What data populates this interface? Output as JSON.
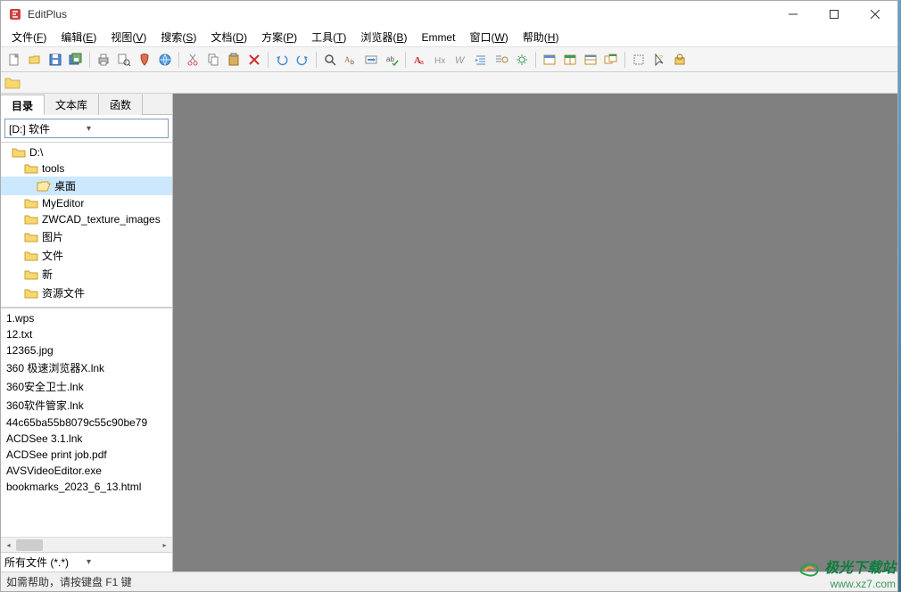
{
  "window": {
    "title": "EditPlus"
  },
  "menubar": [
    {
      "label": "文件",
      "key": "F"
    },
    {
      "label": "编辑",
      "key": "E"
    },
    {
      "label": "视图",
      "key": "V"
    },
    {
      "label": "搜索",
      "key": "S"
    },
    {
      "label": "文档",
      "key": "D"
    },
    {
      "label": "方案",
      "key": "P"
    },
    {
      "label": "工具",
      "key": "T"
    },
    {
      "label": "浏览器",
      "key": "B"
    },
    {
      "label": "Emmet",
      "key": ""
    },
    {
      "label": "窗口",
      "key": "W"
    },
    {
      "label": "帮助",
      "key": "H"
    }
  ],
  "toolbar_icons": [
    "new-file",
    "open-file",
    "save-file",
    "save-all",
    "sep",
    "print",
    "print-preview",
    "toggle-marker",
    "browser-preview",
    "sep",
    "cut",
    "copy",
    "paste",
    "delete",
    "sep",
    "undo",
    "redo",
    "sep",
    "find",
    "replace",
    "goto",
    "spell-check",
    "sep",
    "font-settings",
    "heading",
    "word-wrap",
    "indent",
    "outdent",
    "settings",
    "sep",
    "window-1",
    "window-2",
    "window-3",
    "window-4",
    "sep",
    "cursor-mode",
    "help",
    "preferences"
  ],
  "sidebar": {
    "tabs": [
      "目录",
      "文本库",
      "函数"
    ],
    "active_tab": 0,
    "drive": "[D:] 软件",
    "tree": [
      {
        "label": "D:\\",
        "depth": 0,
        "open": false,
        "selected": false
      },
      {
        "label": "tools",
        "depth": 1,
        "open": false,
        "selected": false
      },
      {
        "label": "桌面",
        "depth": 2,
        "open": true,
        "selected": true
      },
      {
        "label": "MyEditor",
        "depth": 1,
        "open": false,
        "selected": false
      },
      {
        "label": "ZWCAD_texture_images",
        "depth": 1,
        "open": false,
        "selected": false
      },
      {
        "label": "图片",
        "depth": 1,
        "open": false,
        "selected": false
      },
      {
        "label": "文件",
        "depth": 1,
        "open": false,
        "selected": false
      },
      {
        "label": "新",
        "depth": 1,
        "open": false,
        "selected": false
      },
      {
        "label": "资源文件",
        "depth": 1,
        "open": false,
        "selected": false
      }
    ],
    "files": [
      "1.wps",
      "12.txt",
      "12365.jpg",
      "360 极速浏览器X.lnk",
      "360安全卫士.lnk",
      "360软件管家.lnk",
      "44c65ba55b8079c55c90be79",
      "ACDSee 3.1.lnk",
      "ACDSee print job.pdf",
      "AVSVideoEditor.exe",
      "bookmarks_2023_6_13.html"
    ],
    "filter": "所有文件 (*.*)"
  },
  "statusbar": {
    "text": "如需帮助，请按键盘 F1 键"
  },
  "watermark": {
    "line1": "极光下载站",
    "line2": "www.xz7.com"
  }
}
